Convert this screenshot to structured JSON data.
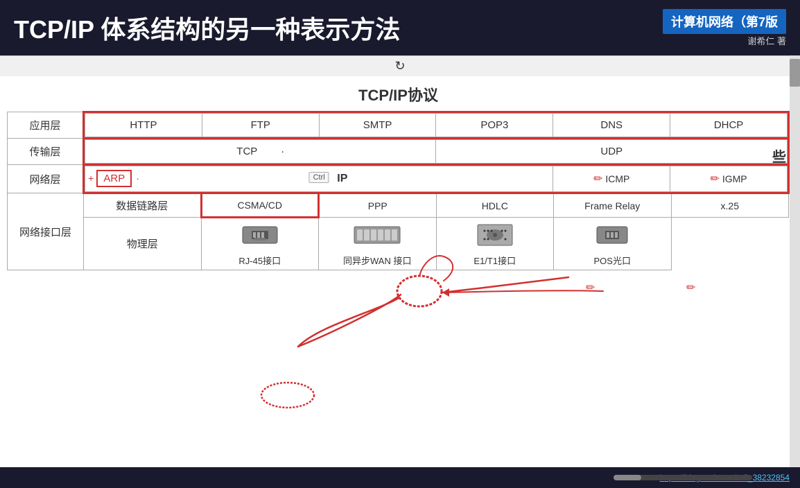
{
  "header": {
    "title": "TCP/IP 体系结构的另一种表示方法",
    "book_title": "计算机网络（第7版",
    "book_author": "谢希仁 著"
  },
  "toolbar": {
    "refresh_icon": "↻"
  },
  "main": {
    "table_title": "TCP/IP协议",
    "layers": {
      "app": "应用层",
      "transport": "传输层",
      "network": "网络层",
      "datalink": "数据链路层",
      "physical": "物理层",
      "network_interface": "网络接口层"
    },
    "protocols": {
      "app_row": [
        "HTTP",
        "FTP",
        "SMTP",
        "POP3",
        "DNS",
        "DHCP"
      ],
      "transport_tcp": "TCP",
      "transport_dot": "·",
      "transport_udp": "UDP",
      "network_icmp": "ICMP",
      "network_igmp": "IGMP",
      "network_arp_prefix": "+",
      "network_arp": "ARP",
      "network_arp_suffix": "·",
      "network_ip": "IP",
      "network_ctrl": "Ctrl",
      "datalink_row": [
        "CSMA/CD",
        "PPP",
        "HDLC",
        "Frame Relay",
        "x.25"
      ],
      "physical_labels": [
        "RJ-45接口",
        "同异步WAN 接口",
        "E1/T1接口",
        "POS光口"
      ]
    }
  },
  "bottom": {
    "url": "https://blog.csdn.net/m0_38232854",
    "page_number": "些"
  }
}
